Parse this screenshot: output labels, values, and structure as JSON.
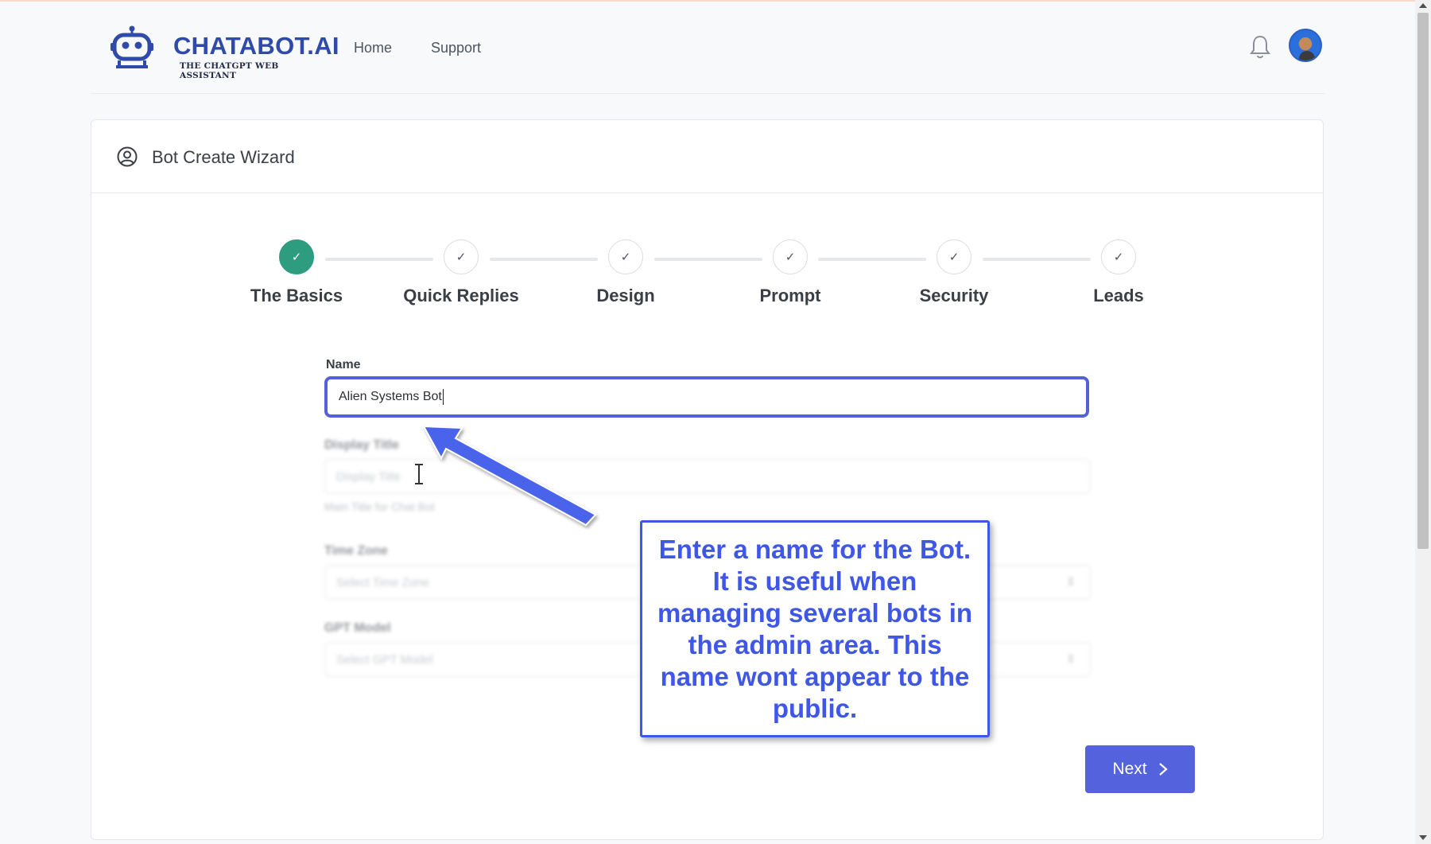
{
  "brand": {
    "name": "CHATABOT.AI",
    "tagline": "THE CHATGPT WEB ASSISTANT",
    "color": "#2f4aa8"
  },
  "nav": {
    "links": [
      "Home",
      "Support"
    ],
    "icons": [
      "bell-icon",
      "user-avatar"
    ]
  },
  "card": {
    "title": "Bot Create Wizard",
    "icon": "user-circle-icon"
  },
  "stepper": {
    "steps": [
      {
        "label": "The Basics",
        "state": "active"
      },
      {
        "label": "Quick Replies",
        "state": "pending"
      },
      {
        "label": "Design",
        "state": "pending"
      },
      {
        "label": "Prompt",
        "state": "pending"
      },
      {
        "label": "Security",
        "state": "pending"
      },
      {
        "label": "Leads",
        "state": "pending"
      }
    ],
    "check_glyph": "✓",
    "active_color": "#2e9c7f"
  },
  "form": {
    "name_label": "Name",
    "name_value": "Alien Systems Bot",
    "display_title_label": "Display Title",
    "display_title_placeholder": "Display Title",
    "display_title_help": "Main Title for Chat Bot",
    "time_zone_label": "Time Zone",
    "time_zone_placeholder": "Select Time Zone",
    "gpt_model_label": "GPT Model",
    "gpt_model_placeholder": "Select GPT Model"
  },
  "callout": {
    "text": "Enter a name for the Bot. It is useful when managing several bots in the admin area. This name wont appear to the public.",
    "color": "#3f57e6"
  },
  "actions": {
    "next_label": "Next",
    "next_color": "#5562dd"
  }
}
